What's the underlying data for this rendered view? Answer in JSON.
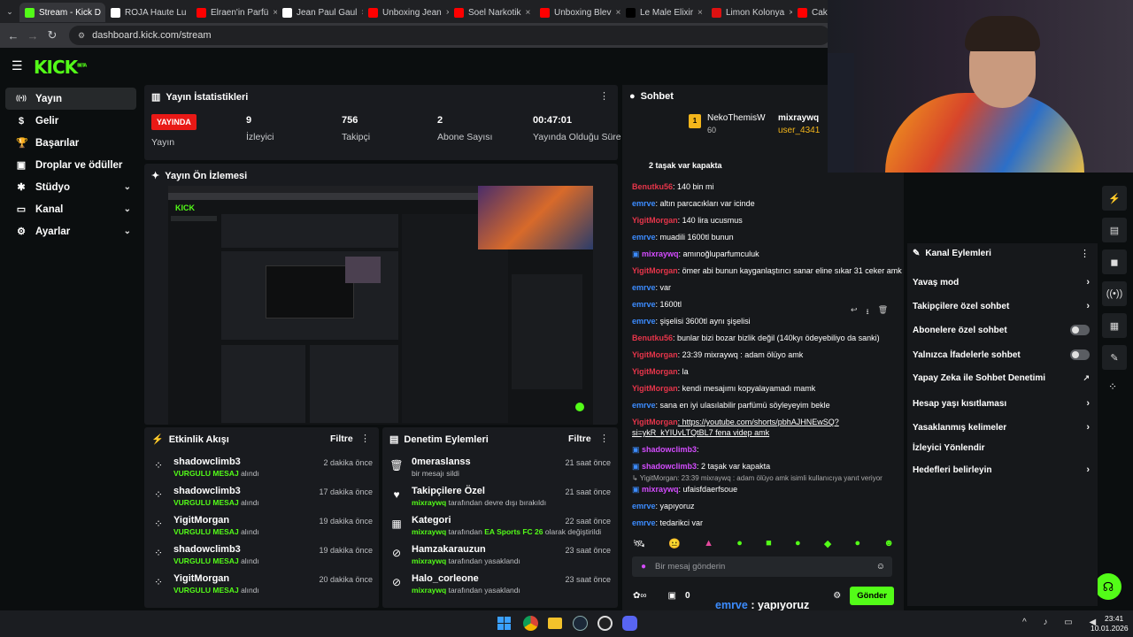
{
  "browser": {
    "tabs": [
      {
        "label": "Stream - Kick D",
        "color": "#53fc18"
      },
      {
        "label": "ROJA Haute Lu",
        "color": "#ffffff"
      },
      {
        "label": "Elraen'in Parfü",
        "color": "#ff0000"
      },
      {
        "label": "Jean Paul Gaul",
        "color": "#ffffff"
      },
      {
        "label": "Unboxing Jean",
        "color": "#ff0000"
      },
      {
        "label": "Soel Narkotik",
        "color": "#ff0000"
      },
      {
        "label": "Unboxing Blev",
        "color": "#ff0000"
      },
      {
        "label": "Le Male Elixir",
        "color": "#000000"
      },
      {
        "label": "Limon Kolonya",
        "color": "#d11"
      },
      {
        "label": "Cakal x Mavi",
        "color": "#ff0000"
      }
    ],
    "url": "dashboard.kick.com/stream"
  },
  "header": {
    "logo": "KICK",
    "logo_sup": "BETA"
  },
  "sidebar": {
    "items": [
      {
        "label": "Yayın",
        "icon": "broadcast-icon",
        "glyph": "((•))"
      },
      {
        "label": "Gelir",
        "icon": "dollar-icon",
        "glyph": "$"
      },
      {
        "label": "Başarılar",
        "icon": "trophy-icon",
        "glyph": "🏆"
      },
      {
        "label": "Droplar ve ödüller",
        "icon": "gift-icon",
        "glyph": "▣"
      },
      {
        "label": "Stüdyo",
        "icon": "palette-icon",
        "glyph": "✱"
      },
      {
        "label": "Kanal",
        "icon": "monitor-icon",
        "glyph": "▭"
      },
      {
        "label": "Ayarlar",
        "icon": "gear-icon",
        "glyph": "⚙"
      }
    ]
  },
  "stats": {
    "title": "Yayın İstatistikleri",
    "live_badge": "YAYINDA",
    "live_label": "Yayın",
    "items": [
      {
        "value": "9",
        "label": "İzleyici"
      },
      {
        "value": "756",
        "label": "Takipçi"
      },
      {
        "value": "2",
        "label": "Abone Sayısı"
      },
      {
        "value": "00:47:01",
        "label": "Yayında Olduğu Süre"
      }
    ]
  },
  "preview": {
    "title": "Yayın Ön İzlemesi"
  },
  "activity": {
    "title": "Etkinlik Akışı",
    "filter": "Filtre",
    "rows": [
      {
        "name": "shadowclimb3",
        "tag": "VURGULU MESAJ",
        "suffix": "alındı",
        "time": "2 dakika önce"
      },
      {
        "name": "shadowclimb3",
        "tag": "VURGULU MESAJ",
        "suffix": "alındı",
        "time": "17 dakika önce"
      },
      {
        "name": "YigitMorgan",
        "tag": "VURGULU MESAJ",
        "suffix": "alındı",
        "time": "19 dakika önce"
      },
      {
        "name": "shadowclimb3",
        "tag": "VURGULU MESAJ",
        "suffix": "alındı",
        "time": "19 dakika önce"
      },
      {
        "name": "YigitMorgan",
        "tag": "VURGULU MESAJ",
        "suffix": "alındı",
        "time": "20 dakika önce"
      }
    ]
  },
  "moderation": {
    "title": "Denetim Eylemleri",
    "filter": "Filtre",
    "rows": [
      {
        "name": "0meraslanss",
        "sub_a": "",
        "sub_b": "bir mesajı sildi",
        "sub_c": "",
        "sub_d": "",
        "time": "21 saat önce",
        "icon": "trash-icon",
        "glyph": "🗑"
      },
      {
        "name": "Takipçilere Özel",
        "sub_a": "mixraywq",
        "sub_b": " tarafından devre dışı bırakıldı",
        "sub_c": "",
        "sub_d": "",
        "time": "21 saat önce",
        "icon": "heart-icon",
        "glyph": "♥"
      },
      {
        "name": "Kategori",
        "sub_a": "mixraywq",
        "sub_b": " tarafından ",
        "sub_c": "EA Sports FC 26",
        "sub_d": " olarak değiştirildi",
        "time": "22 saat önce",
        "icon": "category-icon",
        "glyph": "▦"
      },
      {
        "name": "Hamzakarauzun",
        "sub_a": "mixraywq",
        "sub_b": " tarafından yasaklandı",
        "sub_c": "",
        "sub_d": "",
        "time": "23 saat önce",
        "icon": "ban-icon",
        "glyph": "⊘"
      },
      {
        "name": "Halo_corleone",
        "sub_a": "mixraywq",
        "sub_b": " tarafından yasaklandı",
        "sub_c": "",
        "sub_d": "",
        "time": "23 saat önce",
        "icon": "ban-icon",
        "glyph": "⊘"
      }
    ]
  },
  "chat": {
    "title": "Sohbet",
    "pinned": {
      "user1": "NekoThemisW",
      "user1_count": "60",
      "user2": "mixraywq",
      "user3": "user_4341"
    },
    "top_partial": "2 taşak var kapakta",
    "messages": [
      {
        "user": "Benutku56",
        "cls": "u-red",
        "text": ": 140 bin mi"
      },
      {
        "user": "emrve",
        "cls": "u-blue",
        "text": ": altın parcacıkları var icinde"
      },
      {
        "user": "YigitMorgan",
        "cls": "u-red",
        "text": ": 140 lira ucusmus"
      },
      {
        "user": "emrve",
        "cls": "u-blue",
        "text": ": muadili 1600tl bunun"
      },
      {
        "user": "mixraywq",
        "cls": "u-pink",
        "text": ": amınoğluparfumculuk"
      },
      {
        "user": "YigitMorgan",
        "cls": "u-red",
        "text": ": ömer abi bunun kayganlaştırıcı sanar eline sıkar 31 ceker amk"
      },
      {
        "user": "emrve",
        "cls": "u-blue",
        "text": ": var"
      },
      {
        "user": "emrve",
        "cls": "u-blue",
        "text": ": 1600tl"
      },
      {
        "user": "emrve",
        "cls": "u-blue",
        "text": ": şişelisi 3600tl aynı şişelisi"
      },
      {
        "user": "Benutku56",
        "cls": "u-red",
        "text": ": bunlar bizi bozar bizlik değil (140kyı ödeyebiliyo da sanki)"
      },
      {
        "user": "YigitMorgan",
        "cls": "u-red",
        "text": ": 23:39 mixraywq : adam ölüyo amk"
      },
      {
        "user": "YigitMorgan",
        "cls": "u-red",
        "text": ": la"
      },
      {
        "user": "YigitMorgan",
        "cls": "u-red",
        "text": ": kendi mesajımı kopyalayamadı mamk"
      },
      {
        "user": "emrve",
        "cls": "u-blue",
        "text": ": sana en iyi ulasılabilir parfümü söyleyeyim bekle"
      },
      {
        "user": "YigitMorgan",
        "cls": "u-red",
        "text": ": https://youtube.com/shorts/pbhAJHNEwSQ?"
      },
      {
        "user": "",
        "cls": "u-blue",
        "text": "si=ykR_kYIUvLTQtBL7 fena videp amk"
      },
      {
        "user": "shadowclimb3",
        "cls": "u-pink",
        "text": ":"
      },
      {
        "user": "shadowclimb3",
        "cls": "u-pink",
        "text": ": 2 taşak var kapakta"
      },
      {
        "user": "",
        "cls": "u-blue",
        "text": "↳ YigitMorgan: 23:39 mixraywq : adam ölüyo amk isimli kullanıcıya yanıt veriyor"
      },
      {
        "user": "mixraywq",
        "cls": "u-pink",
        "text": ": ufaisfdaerfsoue"
      },
      {
        "user": "emrve",
        "cls": "u-blue",
        "text": ": yapıyoruz"
      },
      {
        "user": "emrve",
        "cls": "u-blue",
        "text": ": tedarikci var"
      }
    ],
    "input_placeholder": "Bir mesaj gönderin",
    "points": "0",
    "send": "Gönder"
  },
  "channel_actions": {
    "title": "Kanal Eylemleri",
    "items": [
      {
        "label": "Yavaş mod",
        "kind": "arrow"
      },
      {
        "label": "Takipçilere özel sohbet",
        "kind": "arrow"
      },
      {
        "label": "Abonelere özel sohbet",
        "kind": "toggle"
      },
      {
        "label": "Yalnızca İfadelerle sohbet",
        "kind": "toggle"
      },
      {
        "label": "Yapay Zeka ile Sohbet Denetimi",
        "kind": "ext"
      },
      {
        "label": "Hesap yaşı kısıtlaması",
        "kind": "arrow"
      },
      {
        "label": "Yasaklanmış kelimeler",
        "kind": "arrow"
      },
      {
        "label": "İzleyici Yönlendir",
        "kind": "none"
      },
      {
        "label": "Hedefleri belirleyin",
        "kind": "arrow"
      }
    ]
  },
  "overlay_subtitles": [
    {
      "user": "emrve",
      "text": " : yapıyoruz"
    },
    {
      "user": "emrve",
      "text": " : tedarikci var"
    }
  ],
  "taskbar": {
    "time": "23:41",
    "date": "10.01.2026"
  },
  "colors": {
    "accent": "#53fc18",
    "live": "#e91916",
    "panel": "#191b1f"
  }
}
